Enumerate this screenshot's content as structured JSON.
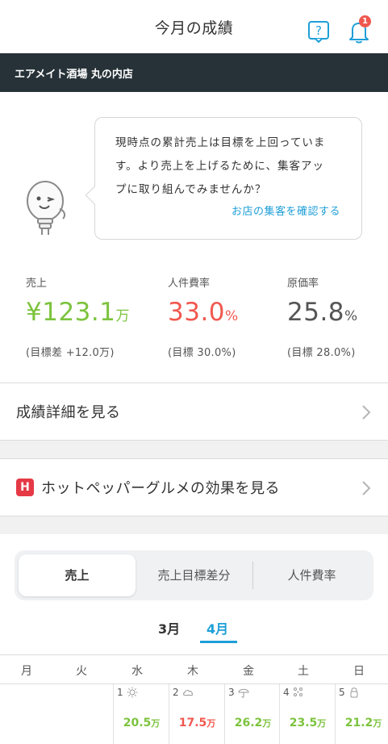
{
  "header": {
    "title": "今月の成績",
    "notification_count": "1"
  },
  "store": {
    "name": "エアメイト酒場 丸の内店"
  },
  "advice": {
    "lines": [
      "現時点の累計売上は目標を上回っていま",
      "す。より売上を上げるために、集客アッ",
      "プに取り組んでみませんか？"
    ],
    "link": "お店の集客を確認する"
  },
  "metrics": {
    "sales": {
      "label": "売上",
      "value": "¥123.1",
      "unit": "万",
      "sub": "(目標差 +12.0万)",
      "color": "#7cc33e"
    },
    "labor": {
      "label": "人件費率",
      "value": "33.0",
      "unit": "%",
      "sub": "(目標 30.0%)",
      "color": "#f0584f"
    },
    "cost": {
      "label": "原価率",
      "value": "25.8",
      "unit": "%",
      "sub": "(目標 28.0%)",
      "color": "#555555"
    }
  },
  "links": {
    "details": "成績詳細を見る",
    "hotpepper": "ホットペッパーグルメの効果を見る",
    "hotpepper_icon_text": "H"
  },
  "tabs": {
    "items": [
      "売上",
      "売上目標差分",
      "人件費率"
    ],
    "active": "売上"
  },
  "months": {
    "items": [
      "3月",
      "4月"
    ],
    "active": "4月"
  },
  "calendar": {
    "weekdays": [
      "月",
      "火",
      "水",
      "木",
      "金",
      "土",
      "日"
    ],
    "days": [
      {
        "num": "1",
        "weather": "sun-icon",
        "value": "20.5",
        "unit": "万",
        "color": "#7cc33e"
      },
      {
        "num": "2",
        "weather": "cloud-icon",
        "value": "17.5",
        "unit": "万",
        "color": "#f0584f"
      },
      {
        "num": "3",
        "weather": "umbrella-icon",
        "value": "26.2",
        "unit": "万",
        "color": "#7cc33e"
      },
      {
        "num": "4",
        "weather": "snow-icon",
        "value": "23.5",
        "unit": "万",
        "color": "#7cc33e"
      },
      {
        "num": "5",
        "weather": "lock-icon",
        "value": "21.2",
        "unit": "万",
        "color": "#7cc33e"
      }
    ]
  },
  "colors": {
    "accent": "#1e9fd8",
    "positive": "#7cc33e",
    "negative": "#f0584f",
    "store_bar": "#263238"
  }
}
